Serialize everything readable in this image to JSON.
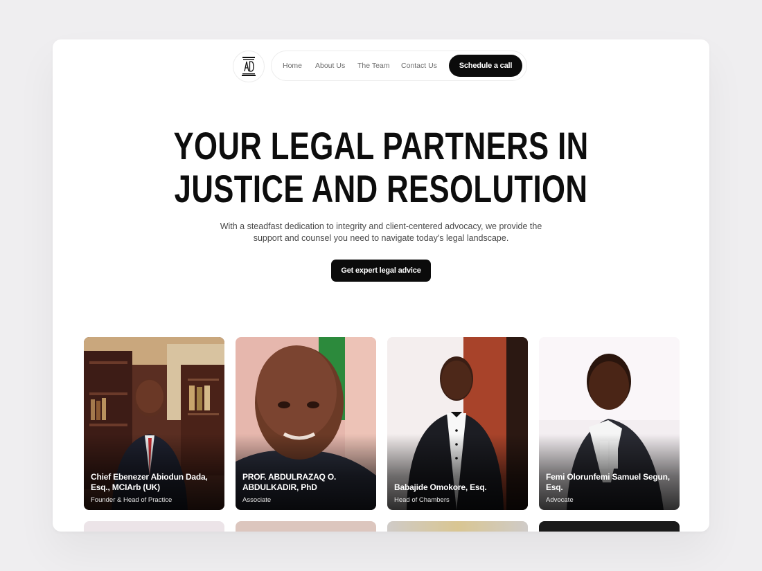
{
  "nav": {
    "logo_alt": "AD logo",
    "links": [
      "Home",
      "About Us",
      "The Team",
      "Contact Us"
    ],
    "cta": "Schedule a call"
  },
  "hero": {
    "title_line1": "Your legal partners in",
    "title_line2": "justice and resolution",
    "subtitle_line1": "With a steadfast dedication to integrity and client-centered advocacy, we provide the",
    "subtitle_line2": "support and counsel you need to navigate today's legal landscape.",
    "cta": "Get expert legal advice"
  },
  "team": [
    {
      "name": "Chief Ebenezer Abiodun Dada, Esq., MCIArb (UK)",
      "role": "Founder & Head of Practice",
      "photo": "portrait-office-bookshelf"
    },
    {
      "name": "PROF. ABDULRAZAQ O. ABDULKADIR, PhD",
      "role": "Associate",
      "photo": "portrait-closeup-flag"
    },
    {
      "name": "Babajide Omokore, Esq.",
      "role": "Head of Chambers",
      "photo": "portrait-tuxedo-doorway"
    },
    {
      "name": "Femi Olorunfemi Samuel Segun, Esq.",
      "role": "Advocate",
      "photo": "portrait-barrister-bib"
    }
  ],
  "colors": {
    "background": "#efeef0",
    "surface": "#ffffff",
    "primary": "#0b0b0b",
    "text": "#0d0d0d",
    "muted": "#6b6b6b"
  }
}
